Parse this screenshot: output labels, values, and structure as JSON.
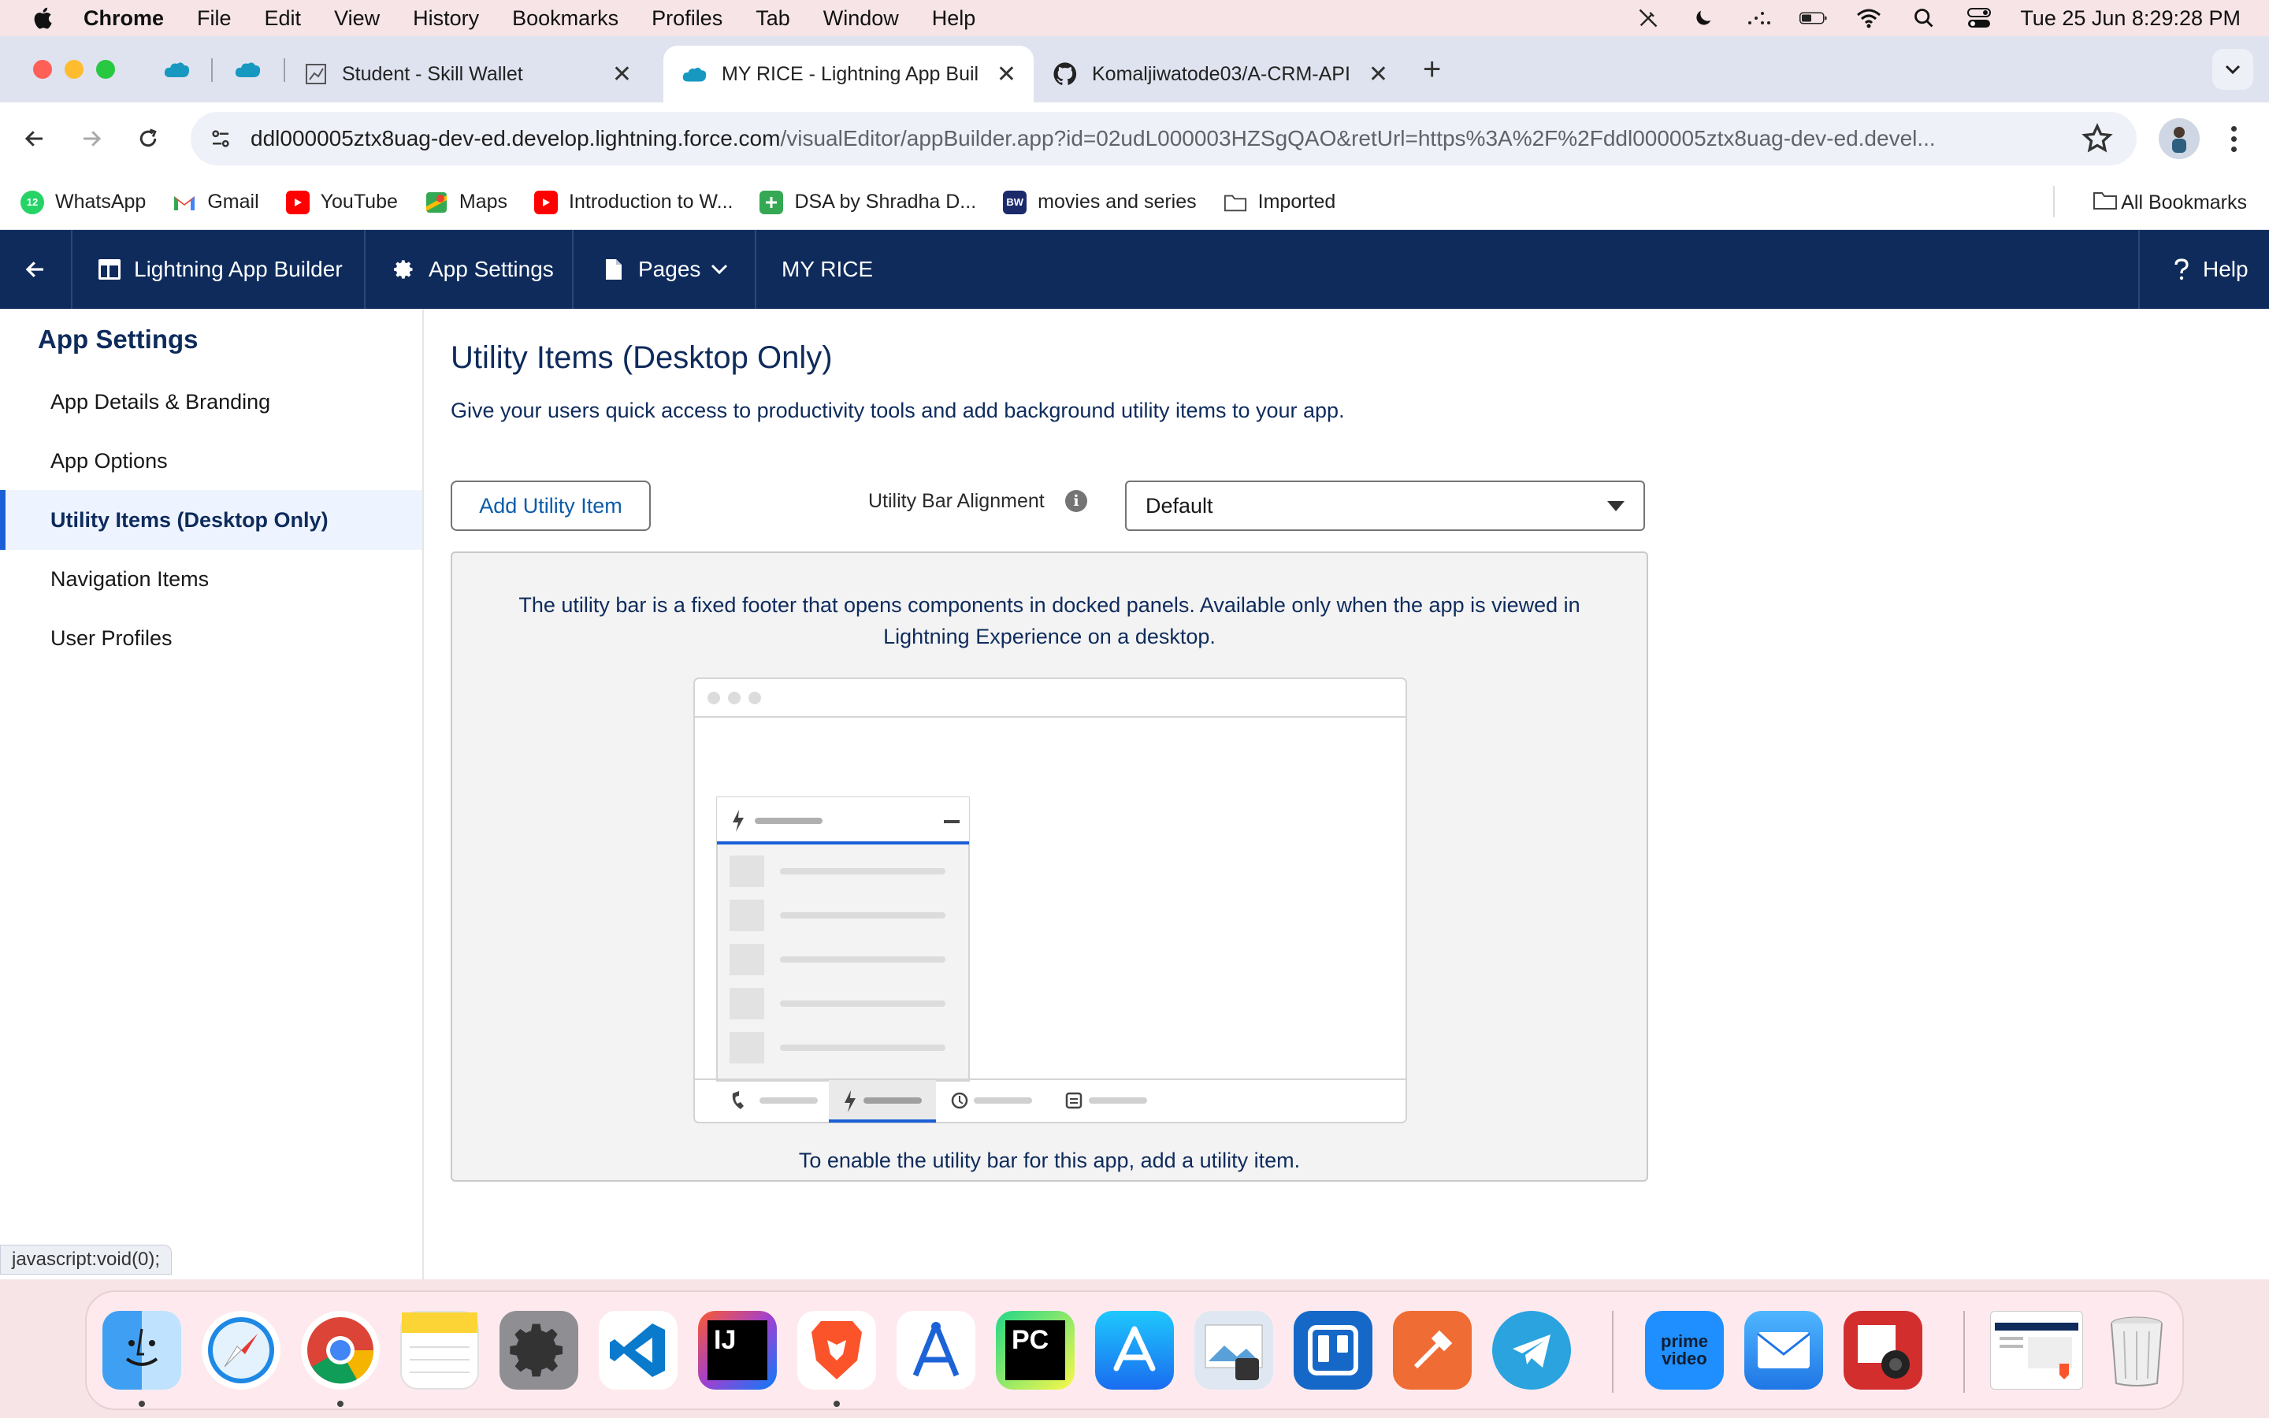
{
  "menubar": {
    "app_name": "Chrome",
    "menus": [
      "File",
      "Edit",
      "View",
      "History",
      "Bookmarks",
      "Profiles",
      "Tab",
      "Window",
      "Help"
    ],
    "clock": "Tue 25 Jun  8:29:28 PM",
    "status_icons": [
      "pen-slash-icon",
      "moon-icon",
      "dots-icon",
      "battery-icon",
      "wifi-icon",
      "spotlight-icon",
      "control-center-icon"
    ]
  },
  "tabs": {
    "items": [
      {
        "title": "Student - Skill Wallet",
        "close": "✕",
        "active": false
      },
      {
        "title": "MY RICE - Lightning App Buil",
        "close": "✕",
        "active": true
      },
      {
        "title": "Komaljiwatode03/A-CRM-API",
        "close": "✕",
        "active": false
      }
    ],
    "new_tab": "+"
  },
  "toolbar": {
    "url_host": "ddl000005ztx8uag-dev-ed.develop.lightning.force.com",
    "url_path": "/visualEditor/appBuilder.app?id=02udL000003HZSgQAO&retUrl=https%3A%2F%2Fddl000005ztx8uag-dev-ed.devel..."
  },
  "bookmarks": {
    "items": [
      "WhatsApp",
      "Gmail",
      "YouTube",
      "Maps",
      "Introduction to W...",
      "DSA by Shradha D...",
      "movies and series",
      "Imported"
    ],
    "all": "All Bookmarks",
    "whatsapp_badge": "12",
    "bw_badge": "BW"
  },
  "sf_header": {
    "builder": "Lightning App Builder",
    "settings": "App Settings",
    "pages": "Pages",
    "app_name": "MY RICE",
    "help": "Help"
  },
  "sidebar": {
    "title": "App Settings",
    "items": [
      "App Details & Branding",
      "App Options",
      "Utility Items (Desktop Only)",
      "Navigation Items",
      "User Profiles"
    ],
    "active_index": 2
  },
  "main": {
    "title": "Utility Items (Desktop Only)",
    "description": "Give your users quick access to productivity tools and add background utility items to your app.",
    "add_button": "Add Utility Item",
    "alignment_label": "Utility Bar Alignment",
    "alignment_value": "Default",
    "info_line1": "The utility bar is a fixed footer that opens components in docked panels. Available only when the app is viewed in",
    "info_line2": "Lightning Experience on a desktop.",
    "footer_text": "To enable the utility bar for this app, add a utility item."
  },
  "status_url": "javascript:void(0);",
  "dock": {
    "apps": [
      "Finder",
      "Safari",
      "Chrome",
      "Notes",
      "System Settings",
      "VS Code",
      "IntelliJ IDEA",
      "Brave",
      "Instruments",
      "PyCharm",
      "App Store",
      "Preview",
      "Trello",
      "Postman",
      "Telegram",
      "Prime Video",
      "Mail",
      "Photo Booth",
      "Trash"
    ],
    "labels": {
      "intellij": "IJ",
      "pycharm": "PC",
      "prime": "prime video"
    }
  },
  "colors": {
    "sf_navy": "#0e2b5c",
    "sf_link_blue": "#0b5cab",
    "active_border": "#1b5fd6"
  }
}
